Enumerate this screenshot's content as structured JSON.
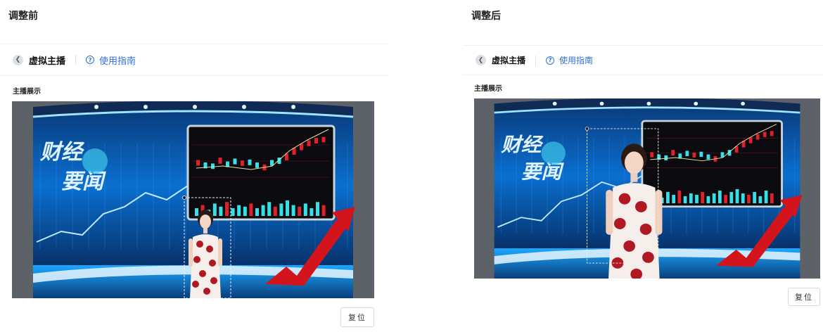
{
  "before": {
    "caption": "调整前",
    "header": {
      "title": "虚拟主播",
      "guide_label": "使用指南"
    },
    "section_label": "主播展示",
    "studio": {
      "logo_line1": "财经",
      "logo_line2": "要闻"
    },
    "reset_label": "复位"
  },
  "after": {
    "caption": "调整后",
    "header": {
      "title": "虚拟主播",
      "guide_label": "使用指南"
    },
    "section_label": "主播展示",
    "studio": {
      "logo_line1": "财经",
      "logo_line2": "要闻"
    },
    "reset_label": "复位"
  },
  "icons": {
    "back": "chevron-left-icon",
    "help": "question-circle-icon"
  },
  "colors": {
    "accent": "#2f6fdb",
    "studio_blue": "#0a6fd0",
    "candle_red": "#e0202a",
    "candle_cyan": "#35e0e8"
  }
}
